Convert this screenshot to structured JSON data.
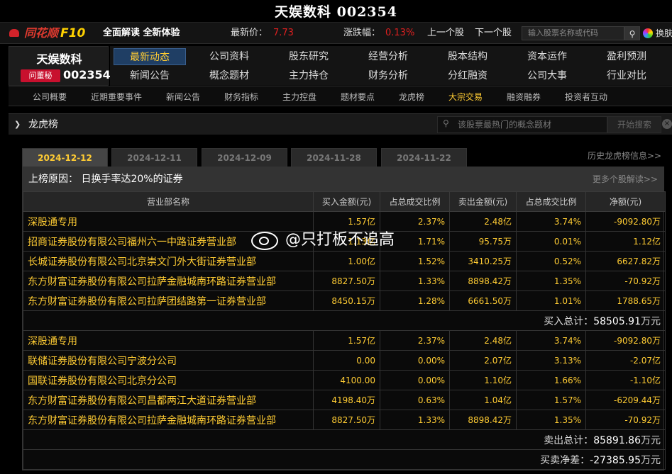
{
  "window": {
    "title": "天娱数科 002354"
  },
  "topbar": {
    "logo_text": "同花顺",
    "logo_f10": "F10",
    "slogan": "全面解读 全新体验",
    "price_label": "最新价：",
    "price_value": "7.73",
    "change_label": "涨跌幅：",
    "change_value": "0.13%",
    "prev_stock": "上一个股",
    "next_stock": "下一个股",
    "search_placeholder": "输入股票名称或代码",
    "skin_label": "换肤"
  },
  "stock": {
    "name": "天娱数科",
    "ask_badge": "问董秘",
    "code": "002354"
  },
  "nav": {
    "row1": [
      "最新动态",
      "公司资料",
      "股东研究",
      "经营分析",
      "股本结构",
      "资本运作",
      "盈利预测"
    ],
    "row2": [
      "新闻公告",
      "概念题材",
      "主力持仓",
      "财务分析",
      "分红融资",
      "公司大事",
      "行业对比"
    ],
    "active": "最新动态"
  },
  "subnav": [
    "公司概要",
    "近期重要事件",
    "新闻公告",
    "财务指标",
    "主力控盘",
    "题材要点",
    "龙虎榜",
    "大宗交易",
    "融资融券",
    "投资者互动"
  ],
  "section": {
    "title": "龙虎榜",
    "concept_placeholder": "该股票最热门的概念题材",
    "concept_button": "开始搜索"
  },
  "date_tabs": [
    "2024-12-12",
    "2024-12-11",
    "2024-12-09",
    "2024-11-28",
    "2024-11-22"
  ],
  "history_link": "历史龙虎榜信息>>",
  "table": {
    "reason": "上榜原因： 日换手率达20%的证券",
    "more_link": "更多个股解读>>",
    "headers": [
      "营业部名称",
      "买入金额(元)",
      "占总成交比例",
      "卖出金额(元)",
      "占总成交比例",
      "净额(元)"
    ],
    "buy_rows": [
      [
        "深股通专用",
        "1.57亿",
        "2.37%",
        "2.48亿",
        "3.74%",
        "-9092.80万"
      ],
      [
        "招商证券股份有限公司福州六一中路证券营业部",
        "1.13亿",
        "1.71%",
        "95.75万",
        "0.01%",
        "1.12亿"
      ],
      [
        "长城证券股份有限公司北京崇文门外大街证券营业部",
        "1.00亿",
        "1.52%",
        "3410.25万",
        "0.52%",
        "6627.82万"
      ],
      [
        "东方财富证券股份有限公司拉萨金融城南环路证券营业部",
        "8827.50万",
        "1.33%",
        "8898.42万",
        "1.35%",
        "-70.92万"
      ],
      [
        "东方财富证券股份有限公司拉萨团结路第一证券营业部",
        "8450.15万",
        "1.28%",
        "6661.50万",
        "1.01%",
        "1788.65万"
      ]
    ],
    "buy_total_label": "买入总计：",
    "buy_total_value": "58505.91",
    "sell_rows": [
      [
        "深股通专用",
        "1.57亿",
        "2.37%",
        "2.48亿",
        "3.74%",
        "-9092.80万"
      ],
      [
        "联储证券股份有限公司宁波分公司",
        "0.00",
        "0.00%",
        "2.07亿",
        "3.13%",
        "-2.07亿"
      ],
      [
        "国联证券股份有限公司北京分公司",
        "4100.00",
        "0.00%",
        "1.10亿",
        "1.66%",
        "-1.10亿"
      ],
      [
        "东方财富证券股份有限公司昌都两江大道证券营业部",
        "4198.40万",
        "0.63%",
        "1.04亿",
        "1.57%",
        "-6209.44万"
      ],
      [
        "东方财富证券股份有限公司拉萨金融城南环路证券营业部",
        "8827.50万",
        "1.33%",
        "8898.42万",
        "1.35%",
        "-70.92万"
      ]
    ],
    "sell_total_label": "卖出总计：",
    "sell_total_value": "85891.86",
    "net_label": "买卖净差：",
    "net_value": "-27385.95",
    "unit": "万元"
  },
  "watermark": {
    "text": "@只打板不追高"
  },
  "colors": {
    "accent": "#ffcc33",
    "up": "#e02020",
    "active_tab_bg": "#1f3e64"
  }
}
